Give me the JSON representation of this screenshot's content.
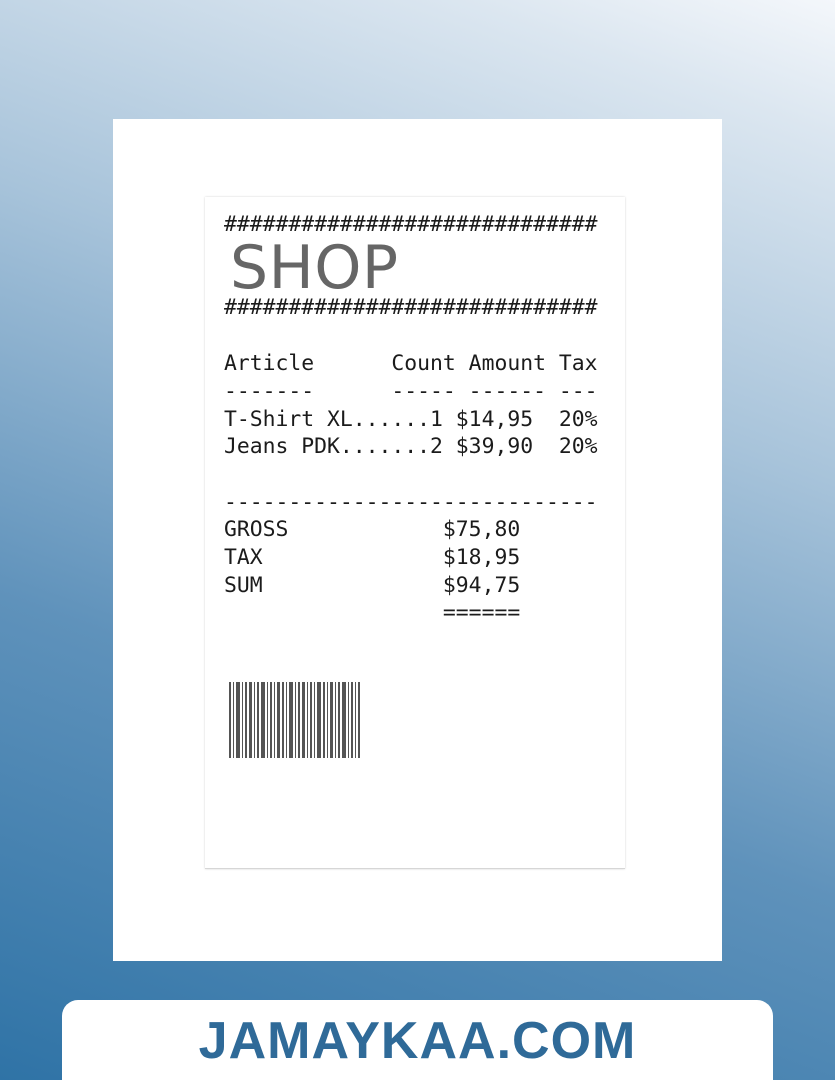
{
  "receipt": {
    "hash_top": "#############################",
    "shop_title": "SHOP",
    "hash_bottom": "#############################",
    "header_line": "Article      Count Amount Tax",
    "header_rule": "-------      ----- ------ ---",
    "items": [
      "T-Shirt XL......1 $14,95  20%",
      "Jeans PDK.......2 $39,90  20%"
    ],
    "total_rule": "-----------------------------",
    "totals": [
      "GROSS            $75,80",
      "TAX              $18,95",
      "SUM              $94,75"
    ],
    "sum_underline": "                 ======"
  },
  "barcode": {
    "icon": "barcode-icon",
    "color": "#555555"
  },
  "footer": {
    "brand": "JAMAYKAA.COM",
    "brand_color": "#2f6a98"
  }
}
